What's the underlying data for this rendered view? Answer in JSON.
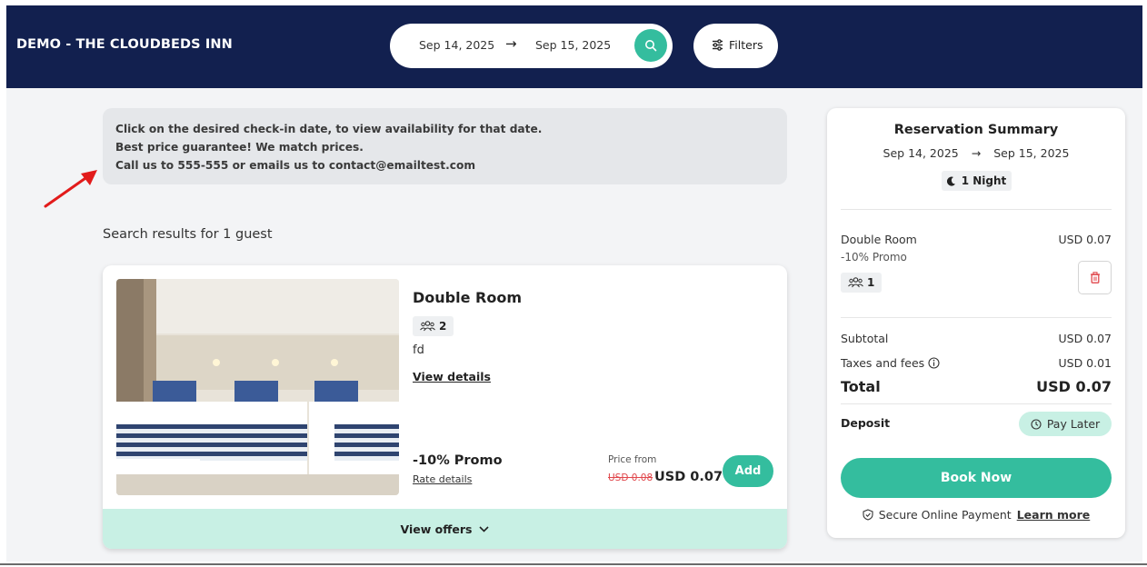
{
  "header": {
    "hotel_name": "DEMO - THE CLOUDBEDS INN",
    "checkin": "Sep 14, 2025",
    "checkout": "Sep 15, 2025",
    "arrow": "→",
    "filters_label": "Filters"
  },
  "info": {
    "line1": "Click on the desired check-in date, to view availability for that date.",
    "line2": "Best price guarantee! We match prices.",
    "line3": "Call us to 555-555 or emails us to contact@emailtest.com"
  },
  "results": {
    "title": "Search results for 1 guest"
  },
  "room": {
    "name": "Double Room",
    "guests": "2",
    "description": "fd",
    "view_details": "View details",
    "promo_name": "-10% Promo",
    "rate_details": "Rate details",
    "price_from_label": "Price from",
    "old_price": "USD 0.08",
    "new_price": "USD 0.07",
    "add_label": "Add",
    "view_offers": "View offers"
  },
  "summary": {
    "title": "Reservation Summary",
    "checkin": "Sep 14, 2025",
    "checkout": "Sep 15, 2025",
    "arrow": "→",
    "nights": "1 Night",
    "room_name": "Double Room",
    "room_price": "USD 0.07",
    "promo": "-10% Promo",
    "guests": "1",
    "subtotal_label": "Subtotal",
    "subtotal_value": "USD 0.07",
    "taxes_label": "Taxes and fees",
    "taxes_value": "USD 0.01",
    "total_label": "Total",
    "total_value": "USD 0.07",
    "deposit_label": "Deposit",
    "pay_later": "Pay Later",
    "book_now": "Book Now",
    "secure_text": "Secure Online Payment",
    "learn_more": "Learn more"
  },
  "colors": {
    "header_bg": "#12204f",
    "accent": "#34bd9e",
    "accent_light": "#c8f0e4",
    "strike": "#e0464b"
  },
  "icons": [
    "search-icon",
    "filters-icon",
    "guests-icon",
    "moon-icon",
    "trash-icon",
    "info-icon",
    "clock-icon",
    "shield-icon",
    "chevron-down-icon",
    "arrow-right-icon"
  ]
}
